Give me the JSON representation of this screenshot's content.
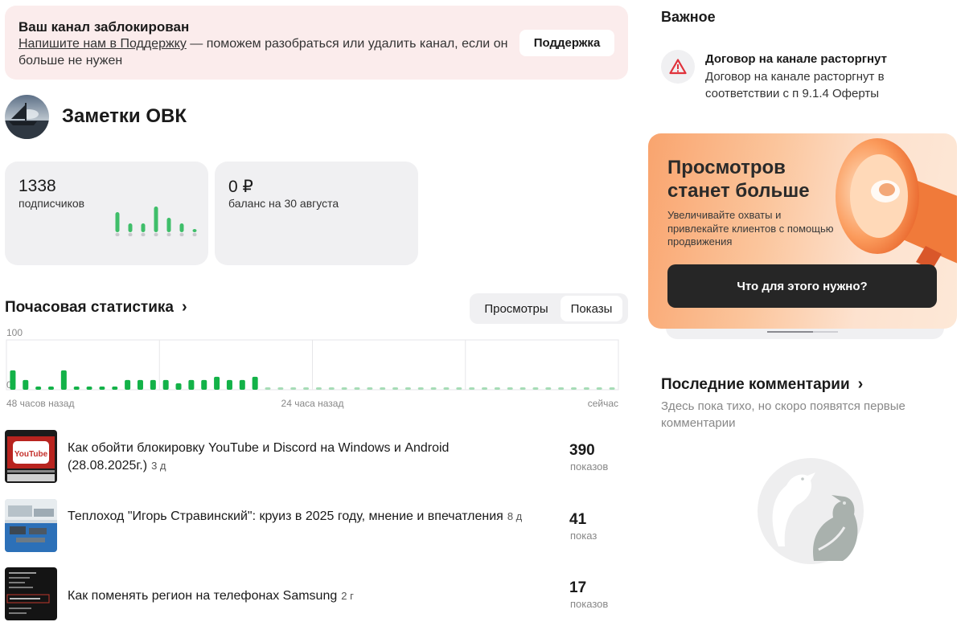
{
  "banner": {
    "title": "Ваш канал заблокирован",
    "link_text": "Напишите нам в Поддержку",
    "text_rest": " — поможем разобраться или удалить канал, если он больше не нужен",
    "button": "Поддержка"
  },
  "channel": {
    "name": "Заметки ОВК"
  },
  "stats": {
    "subscribers_value": "1338",
    "subscribers_label": "подписчиков",
    "balance_value": "0 ₽",
    "balance_label": "баланс на 30 августа"
  },
  "hourly": {
    "title": "Почасовая статистика",
    "chevron": "›",
    "tabs": [
      "Просмотры",
      "Показы"
    ],
    "selected_tab": "Показы"
  },
  "chart_data": {
    "type": "bar",
    "ylim": [
      0,
      100
    ],
    "y_tick_labels": [
      "100",
      "0"
    ],
    "x_tick_labels": [
      "48 часов назад",
      "24 часа назад",
      "сейчас"
    ],
    "grid": true,
    "values": [
      6,
      3,
      1,
      1,
      6,
      1,
      1,
      1,
      1,
      3,
      3,
      3,
      3,
      2,
      3,
      3,
      4,
      3,
      3,
      4,
      0,
      0,
      0,
      0,
      0,
      0,
      0,
      0,
      0,
      0,
      0,
      0,
      0,
      0,
      0,
      0,
      0,
      0,
      0,
      0,
      0,
      0,
      0,
      0,
      0,
      0,
      0,
      0
    ],
    "color_current": "#13b248",
    "color_future": "#a6dcb6"
  },
  "subscriber_spark": [
    3,
    1,
    1,
    4,
    2,
    1,
    0
  ],
  "posts": [
    {
      "title": "Как обойти блокировку YouTube и Discord на Windows и Android (28.08.2025г.)",
      "age": "3 д",
      "count": "390",
      "count_label": "показов"
    },
    {
      "title": "Теплоход \"Игорь Стравинский\": круиз в 2025 году, мнение и впечатления",
      "age": "8 д",
      "count": "41",
      "count_label": "показ"
    },
    {
      "title": "Как поменять регион на телефонах Samsung",
      "age": "2 г",
      "count": "17",
      "count_label": "показов"
    }
  ],
  "important": {
    "title": "Важное",
    "icon": "warning-icon",
    "item_title": "Договор на канале расторгнут",
    "item_text": "Договор на канале расторгнут в соответствии с п 9.1.4 Оферты"
  },
  "promo": {
    "headline": "Просмотров станет больше",
    "subtitle": "Увеличивайте охваты и привлекайте клиентов с помощью продвижения",
    "button": "Что для этого нужно?",
    "carousel_progress": 0.65
  },
  "comments": {
    "title": "Последние комментарии",
    "chevron": "›",
    "empty_text": "Здесь пока тихо, но скоро появятся первые комментарии"
  },
  "thumb_youtube_text": "YouTube"
}
